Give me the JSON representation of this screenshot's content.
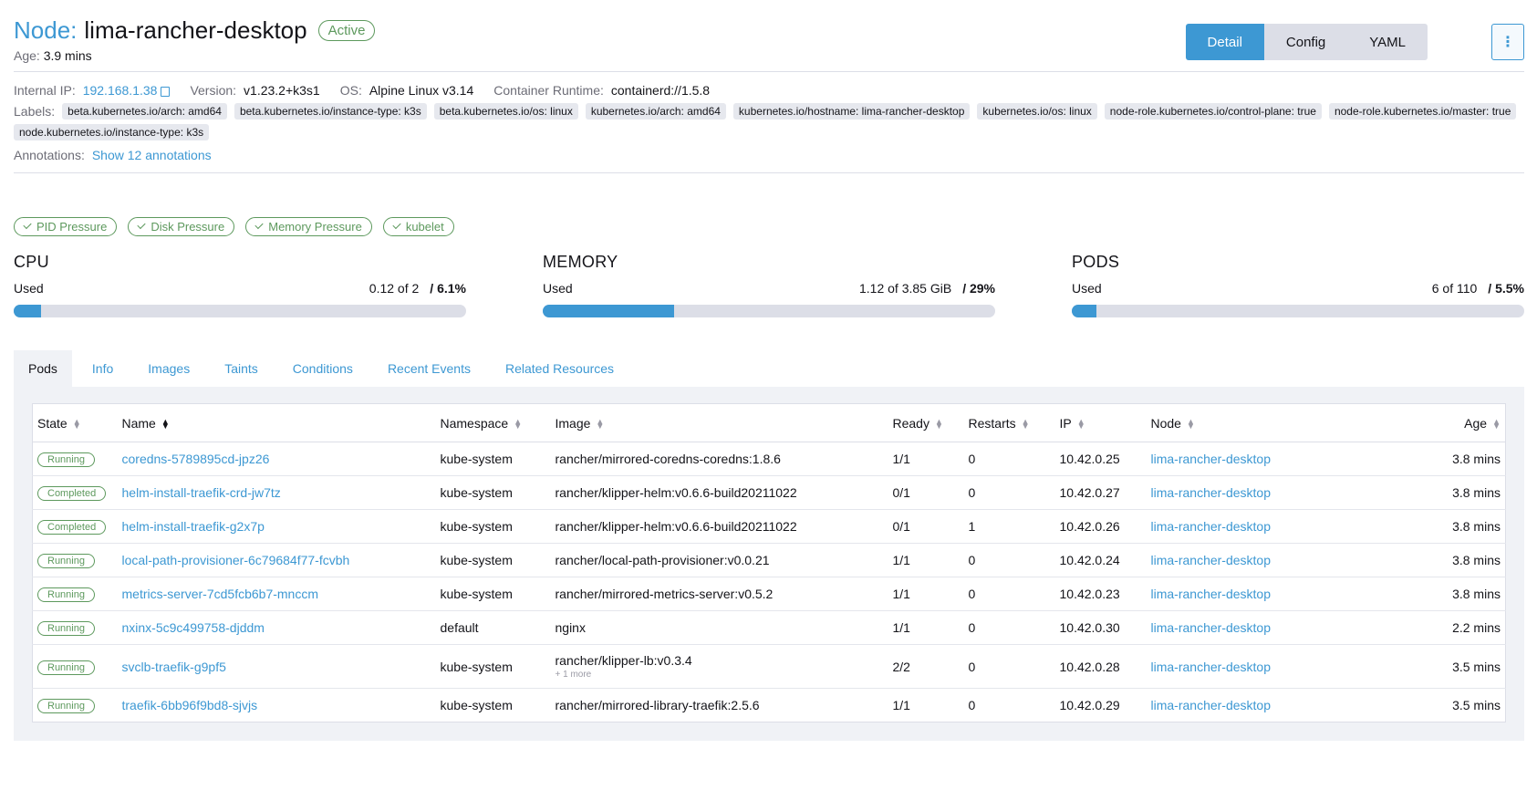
{
  "header": {
    "prefix": "Node:",
    "name": "lima-rancher-desktop",
    "status": "Active",
    "age_label": "Age:",
    "age_value": "3.9 mins",
    "views": [
      "Detail",
      "Config",
      "YAML"
    ],
    "kebab": "⋮"
  },
  "meta": {
    "internal_ip_label": "Internal IP:",
    "internal_ip": "192.168.1.38",
    "version_label": "Version:",
    "version": "v1.23.2+k3s1",
    "os_label": "OS:",
    "os": "Alpine Linux v3.14",
    "runtime_label": "Container Runtime:",
    "runtime": "containerd://1.5.8",
    "labels_label": "Labels:",
    "labels": [
      "beta.kubernetes.io/arch: amd64",
      "beta.kubernetes.io/instance-type: k3s",
      "beta.kubernetes.io/os: linux",
      "kubernetes.io/arch: amd64",
      "kubernetes.io/hostname: lima-rancher-desktop",
      "kubernetes.io/os: linux",
      "node-role.kubernetes.io/control-plane: true",
      "node-role.kubernetes.io/master: true",
      "node.kubernetes.io/instance-type: k3s"
    ],
    "annotations_label": "Annotations:",
    "annotations_link": "Show 12 annotations"
  },
  "conditions": [
    "PID Pressure",
    "Disk Pressure",
    "Memory Pressure",
    "kubelet"
  ],
  "gauges": [
    {
      "title": "CPU",
      "used_label": "Used",
      "value": "0.12 of 2",
      "percent": "/ 6.1%",
      "fill": 0.061
    },
    {
      "title": "MEMORY",
      "used_label": "Used",
      "value": "1.12 of 3.85 GiB",
      "percent": "/ 29%",
      "fill": 0.29
    },
    {
      "title": "PODS",
      "used_label": "Used",
      "value": "6 of 110",
      "percent": "/ 5.5%",
      "fill": 0.055
    }
  ],
  "tabs": [
    "Pods",
    "Info",
    "Images",
    "Taints",
    "Conditions",
    "Recent Events",
    "Related Resources"
  ],
  "table": {
    "headers": [
      "State",
      "Name",
      "Namespace",
      "Image",
      "Ready",
      "Restarts",
      "IP",
      "Node",
      "Age"
    ],
    "rows": [
      {
        "state": "Running",
        "name": "coredns-5789895cd-jpz26",
        "namespace": "kube-system",
        "image": "rancher/mirrored-coredns-coredns:1.8.6",
        "more": "",
        "ready": "1/1",
        "restarts": "0",
        "ip": "10.42.0.25",
        "node": "lima-rancher-desktop",
        "age": "3.8 mins"
      },
      {
        "state": "Completed",
        "name": "helm-install-traefik-crd-jw7tz",
        "namespace": "kube-system",
        "image": "rancher/klipper-helm:v0.6.6-build20211022",
        "more": "",
        "ready": "0/1",
        "restarts": "0",
        "ip": "10.42.0.27",
        "node": "lima-rancher-desktop",
        "age": "3.8 mins"
      },
      {
        "state": "Completed",
        "name": "helm-install-traefik-g2x7p",
        "namespace": "kube-system",
        "image": "rancher/klipper-helm:v0.6.6-build20211022",
        "more": "",
        "ready": "0/1",
        "restarts": "1",
        "ip": "10.42.0.26",
        "node": "lima-rancher-desktop",
        "age": "3.8 mins"
      },
      {
        "state": "Running",
        "name": "local-path-provisioner-6c79684f77-fcvbh",
        "namespace": "kube-system",
        "image": "rancher/local-path-provisioner:v0.0.21",
        "more": "",
        "ready": "1/1",
        "restarts": "0",
        "ip": "10.42.0.24",
        "node": "lima-rancher-desktop",
        "age": "3.8 mins"
      },
      {
        "state": "Running",
        "name": "metrics-server-7cd5fcb6b7-mnccm",
        "namespace": "kube-system",
        "image": "rancher/mirrored-metrics-server:v0.5.2",
        "more": "",
        "ready": "1/1",
        "restarts": "0",
        "ip": "10.42.0.23",
        "node": "lima-rancher-desktop",
        "age": "3.8 mins"
      },
      {
        "state": "Running",
        "name": "nxinx-5c9c499758-djddm",
        "namespace": "default",
        "image": "nginx",
        "more": "",
        "ready": "1/1",
        "restarts": "0",
        "ip": "10.42.0.30",
        "node": "lima-rancher-desktop",
        "age": "2.2 mins"
      },
      {
        "state": "Running",
        "name": "svclb-traefik-g9pf5",
        "namespace": "kube-system",
        "image": "rancher/klipper-lb:v0.3.4",
        "more": "+ 1 more",
        "ready": "2/2",
        "restarts": "0",
        "ip": "10.42.0.28",
        "node": "lima-rancher-desktop",
        "age": "3.5 mins"
      },
      {
        "state": "Running",
        "name": "traefik-6bb96f9bd8-sjvjs",
        "namespace": "kube-system",
        "image": "rancher/mirrored-library-traefik:2.5.6",
        "more": "",
        "ready": "1/1",
        "restarts": "0",
        "ip": "10.42.0.29",
        "node": "lima-rancher-desktop",
        "age": "3.5 mins"
      }
    ]
  },
  "colors": {
    "accent": "#3d98d3",
    "success": "#5d995d"
  }
}
